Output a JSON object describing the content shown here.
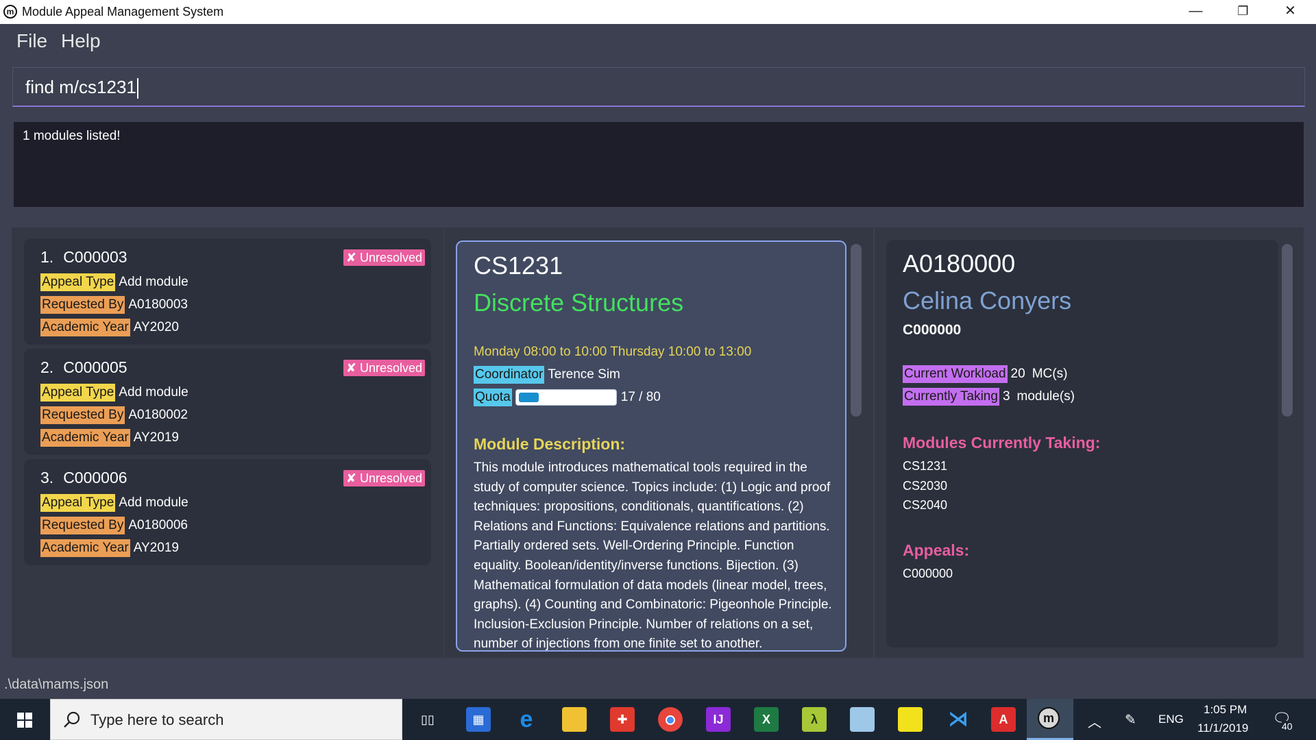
{
  "window": {
    "title": "Module Appeal Management System",
    "icon_letter": "m",
    "minimize_label": "—",
    "restore_label": "❐",
    "close_label": "✕"
  },
  "menu": {
    "file_label": "File",
    "help_label": "Help"
  },
  "command": {
    "value": "find m/cs1231"
  },
  "result": {
    "message": "1 modules listed!"
  },
  "appeals": [
    {
      "index": "1.",
      "id": "C000003",
      "status": "Unresolved",
      "appeal_type_label": "Appeal Type",
      "appeal_type": "Add module",
      "requested_by_label": "Requested By",
      "requested_by": "A0180003",
      "academic_year_label": "Academic Year",
      "academic_year": "AY2020"
    },
    {
      "index": "2.",
      "id": "C000005",
      "status": "Unresolved",
      "appeal_type_label": "Appeal Type",
      "appeal_type": "Add module",
      "requested_by_label": "Requested By",
      "requested_by": "A0180002",
      "academic_year_label": "Academic Year",
      "academic_year": "AY2019"
    },
    {
      "index": "3.",
      "id": "C000006",
      "status": "Unresolved",
      "appeal_type_label": "Appeal Type",
      "appeal_type": "Add module",
      "requested_by_label": "Requested By",
      "requested_by": "A0180006",
      "academic_year_label": "Academic Year",
      "academic_year": "AY2019"
    }
  ],
  "module": {
    "code": "CS1231",
    "name": "Discrete Structures",
    "timeslot": "Monday 08:00 to 10:00 Thursday 10:00 to 13:00",
    "coordinator_label": "Coordinator",
    "coordinator": "Terence Sim",
    "quota_label": "Quota",
    "quota_text": "17 / 80",
    "quota_fraction": 0.2125,
    "description_title": "Module Description:",
    "description": "This module introduces mathematical tools required in the study of computer science. Topics include: (1) Logic and proof techniques: propositions, conditionals, quantifications. (2) Relations and Functions: Equivalence relations and partitions. Partially ordered sets. Well-Ordering Principle. Function equality. Boolean/identity/inverse functions. Bijection. (3) Mathematical formulation of data models (linear model, trees, graphs). (4) Counting and Combinatoric: Pigeonhole Principle. Inclusion-Exclusion Principle. Number of relations on a set, number of injections from one finite set to another."
  },
  "student": {
    "matric": "A0180000",
    "name": "Celina Conyers",
    "appeal_id": "C000000",
    "workload_label": "Current Workload",
    "workload_value": "20",
    "workload_unit": "MC(s)",
    "taking_label": "Currently Taking",
    "taking_value": "3",
    "taking_unit": "module(s)",
    "modules_title": "Modules Currently Taking:",
    "modules": [
      "CS1231",
      "CS2030",
      "CS2040"
    ],
    "appeals_title": "Appeals:",
    "appeals": [
      "C000000"
    ]
  },
  "status_bar": {
    "path": ".\\data\\mams.json"
  },
  "taskbar": {
    "search_placeholder": "Type here to search",
    "language": "ENG",
    "time": "1:05 PM",
    "date": "11/1/2019",
    "notification_count": "40",
    "apps": [
      "task-view-icon",
      "store-icon",
      "edge-icon",
      "file-explorer-icon",
      "gift-icon",
      "chrome-icon",
      "intellij-icon",
      "excel-icon",
      "lambda-app-icon",
      "paper-app-icon",
      "sticky-notes-icon",
      "vscode-icon",
      "angular-icon",
      "mams-icon"
    ]
  },
  "colors": {
    "accent_purple": "#8a72d8",
    "unresolved": "#e85e9e",
    "tag_yellow": "#f2d64b",
    "tag_orange": "#eb9e55",
    "tag_cyan": "#56c8ec",
    "tag_purple": "#c36ef0",
    "module_name": "#44e060",
    "student_name": "#7ea2d2",
    "section_pink": "#e85ea0"
  }
}
